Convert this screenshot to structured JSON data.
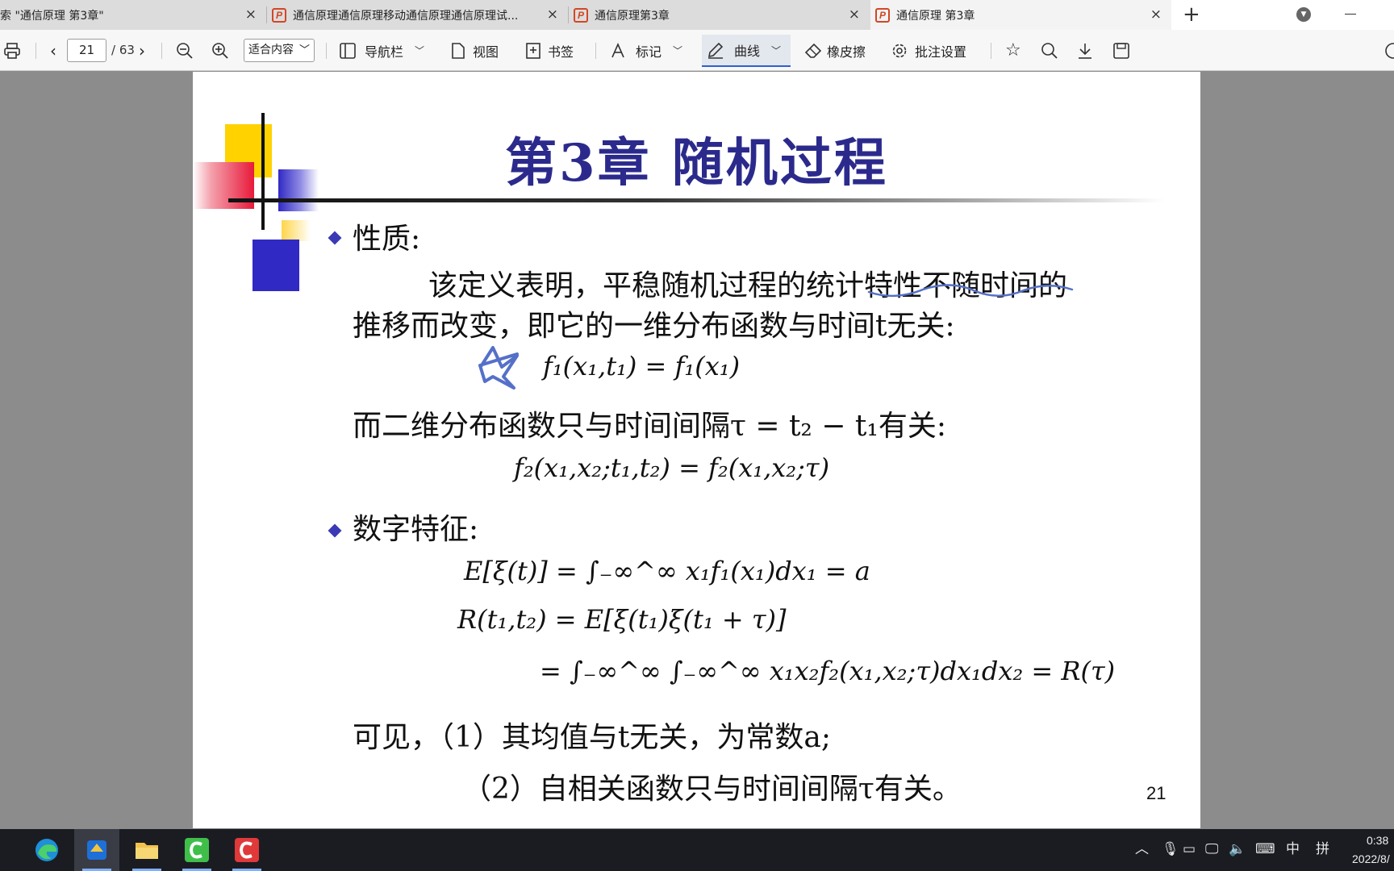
{
  "tabs": [
    {
      "title": "索 \"通信原理 第3章\"",
      "close": "×"
    },
    {
      "title": "通信原理通信原理移动通信原理通信原理试...",
      "close": "×"
    },
    {
      "title": "通信原理第3章",
      "close": "×"
    },
    {
      "title": "通信原理 第3章",
      "close": "×"
    }
  ],
  "tab_add": "+",
  "ppt_letter": "P",
  "toolbar": {
    "page_current": "21",
    "page_total": "/ 63",
    "zoom_value": "适合内容",
    "nav_label": "导航栏",
    "view_label": "视图",
    "bookmark_label": "书签",
    "mark_label": "标记",
    "curve_label": "曲线",
    "eraser_label": "橡皮擦",
    "annot_settings_label": "批注设置"
  },
  "slide": {
    "title": "第3章 随机过程",
    "sec1": "性质:",
    "para1_line1": "该定义表明，平稳随机过程的统计特性不随时间的",
    "para1_line2": "推移而改变，即它的一维分布函数与时间t无关:",
    "eq1": "f₁(x₁,t₁) = f₁(x₁)",
    "para2": "而二维分布函数只与时间间隔τ = t₂ − t₁有关:",
    "eq2": "f₂(x₁,x₂;t₁,t₂) = f₂(x₁,x₂;τ)",
    "sec2": "数字特征:",
    "eq3": "E[ξ(t)] = ∫₋∞^∞ x₁f₁(x₁)dx₁ = a",
    "eq4": "R(t₁,t₂) = E[ξ(t₁)ξ(t₁ + τ)]",
    "eq5": "= ∫₋∞^∞ ∫₋∞^∞ x₁x₂f₂(x₁,x₂;τ)dx₁dx₂ = R(τ)",
    "concl1": "可见，（1）其均值与t无关，为常数a;",
    "concl2": "（2）自相关函数只与时间间隔τ有关。",
    "page_number": "21"
  },
  "taskbar": {
    "ime_lang": "中",
    "ime_mode": "拼",
    "clock_time": "0:38",
    "clock_date": "2022/8/"
  },
  "colors": {
    "title": "#2b2a8c",
    "bullet": "#3b3ab5",
    "annotation_ink": "#5570c8",
    "deco_yellow": "#ffd200",
    "deco_red": "#e8193a",
    "deco_blue": "#3129c4"
  }
}
